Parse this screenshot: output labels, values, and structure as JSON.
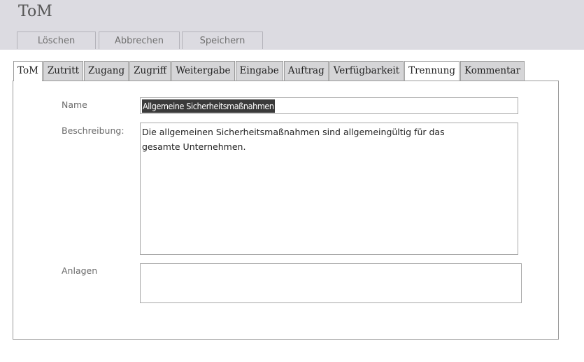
{
  "header": {
    "title": "ToM"
  },
  "toolbar": {
    "delete_label": "Löschen",
    "cancel_label": "Abbrechen",
    "save_label": "Speichern"
  },
  "tabs": [
    {
      "label": "ToM",
      "active": true
    },
    {
      "label": "Zutritt"
    },
    {
      "label": "Zugang"
    },
    {
      "label": "Zugriff"
    },
    {
      "label": "Weitergabe"
    },
    {
      "label": "Eingabe"
    },
    {
      "label": "Auftrag"
    },
    {
      "label": "Verfügbarkeit"
    },
    {
      "label": "Trennung"
    },
    {
      "label": "Kommentar"
    }
  ],
  "form": {
    "name_label": "Name",
    "name_value": "Allgemeine Sicherheitsmaßnahmen",
    "description_label": "Beschreibung:",
    "description_value": "Die allgemeinen Sicherheitsmaßnahmen sind allgemeingültig für das gesamte Unternehmen.",
    "attachments_label": "Anlagen"
  }
}
